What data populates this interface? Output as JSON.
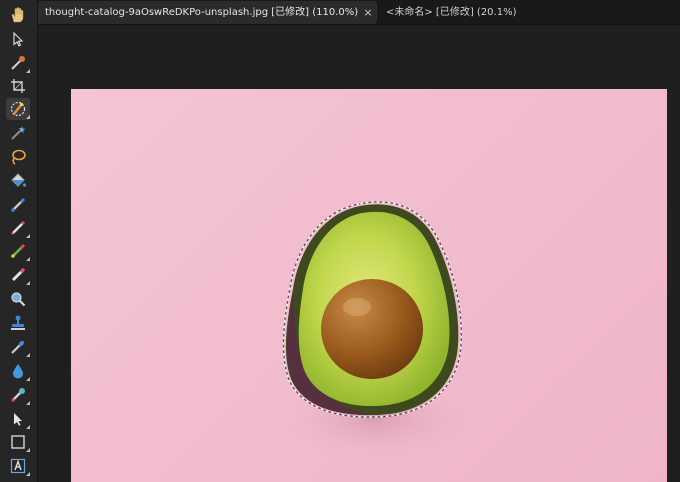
{
  "tabs": [
    {
      "title": "thought-catalog-9aOswReDKPo-unsplash.jpg [已修改] (110.0%)",
      "close": "×"
    },
    {
      "title": "<未命名> [已修改] (20.1%)"
    }
  ],
  "tools": [
    {
      "name": "hand-tool",
      "icon": "hand-icon"
    },
    {
      "name": "move-tool",
      "icon": "pointer-icon"
    },
    {
      "name": "color-picker-tool",
      "icon": "eyedropper-icon"
    },
    {
      "name": "crop-tool",
      "icon": "crop-icon"
    },
    {
      "name": "selection-brush-tool",
      "icon": "selection-brush-icon"
    },
    {
      "name": "magic-wand-tool",
      "icon": "magic-wand-icon"
    },
    {
      "name": "freehand-selection-tool",
      "icon": "lasso-icon"
    },
    {
      "name": "fill-tool",
      "icon": "paint-bucket-icon"
    },
    {
      "name": "paint-brush-tool",
      "icon": "brush-icon"
    },
    {
      "name": "pixel-tool",
      "icon": "pencil-icon"
    },
    {
      "name": "mixer-brush-tool",
      "icon": "color-brush-icon"
    },
    {
      "name": "erase-brush-tool",
      "icon": "eraser-icon"
    },
    {
      "name": "zoom-tool",
      "icon": "magnifier-icon"
    },
    {
      "name": "clone-tool",
      "icon": "stamp-icon"
    },
    {
      "name": "healing-tool",
      "icon": "patch-icon"
    },
    {
      "name": "blur-tool",
      "icon": "drop-icon"
    },
    {
      "name": "smudge-tool",
      "icon": "smudge-icon"
    },
    {
      "name": "node-tool",
      "icon": "node-pointer-icon"
    },
    {
      "name": "rectangle-tool",
      "icon": "rectangle-icon"
    },
    {
      "name": "text-tool",
      "icon": "text-frame-icon"
    }
  ],
  "colors": {
    "canvas_bg": "#f2bfd0",
    "avocado_skin": "#3f4a20",
    "avocado_flesh": "#b4cf43",
    "pit": "#9c5a1e"
  }
}
